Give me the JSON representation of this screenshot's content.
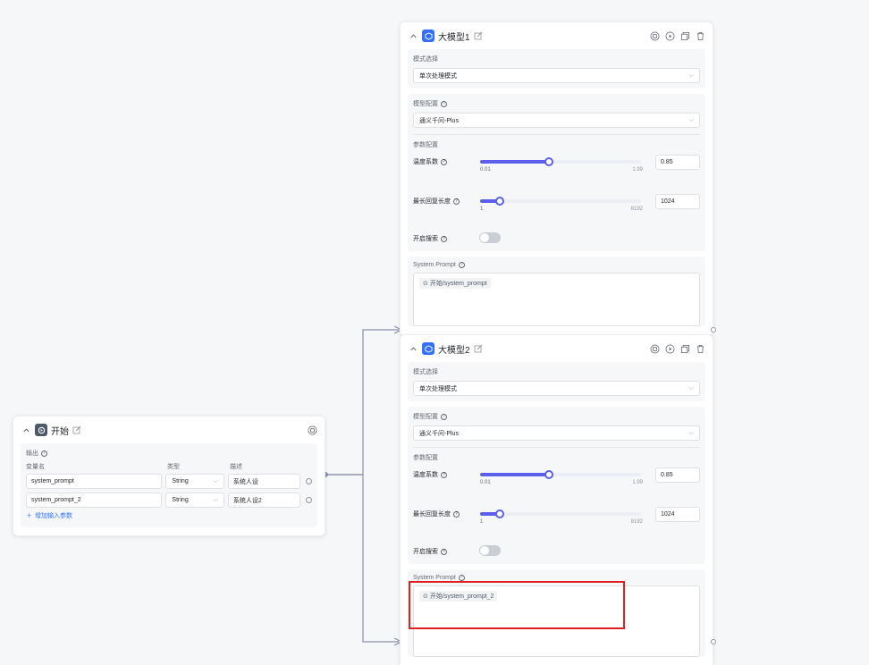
{
  "start_node": {
    "title": "开始",
    "output_label": "输出",
    "columns": {
      "name": "变量名",
      "type": "类型",
      "desc": "描述"
    },
    "variables": [
      {
        "name": "system_prompt",
        "type": "String",
        "desc": "系统人设"
      },
      {
        "name": "system_prompt_2",
        "type": "String",
        "desc": "系统人设2"
      }
    ],
    "add_label": "增加输入参数"
  },
  "llm_nodes": [
    {
      "title": "大模型1",
      "mode_label": "模式选择",
      "mode_value": "单次处理模式",
      "model_label": "模型配置",
      "model_value": "通义千问-Plus",
      "params_label": "参数配置",
      "temperature": {
        "label": "温度系数",
        "value": "0.85",
        "min": "0.01",
        "max": "1.99",
        "level": 0.43
      },
      "max_length": {
        "label": "最长回复长度",
        "value": "1024",
        "min": "1",
        "max": "8192",
        "level": 0.12
      },
      "search": {
        "label": "开启搜索",
        "enabled": false
      },
      "prompt_label": "System Prompt",
      "prompt_ref": "开始/system_prompt"
    },
    {
      "title": "大模型2",
      "mode_label": "模式选择",
      "mode_value": "单次处理模式",
      "model_label": "模型配置",
      "model_value": "通义千问-Plus",
      "params_label": "参数配置",
      "temperature": {
        "label": "温度系数",
        "value": "0.85",
        "min": "0.01",
        "max": "1.99",
        "level": 0.43
      },
      "max_length": {
        "label": "最长回复长度",
        "value": "1024",
        "min": "1",
        "max": "8192",
        "level": 0.12
      },
      "search": {
        "label": "开启搜索",
        "enabled": false
      },
      "prompt_label": "System Prompt",
      "prompt_ref": "开始/system_prompt_2"
    }
  ],
  "colors": {
    "accent": "#5b5fe9",
    "link": "#3370ff",
    "highlight": "#e02020",
    "edge": "#8a8fa8"
  }
}
